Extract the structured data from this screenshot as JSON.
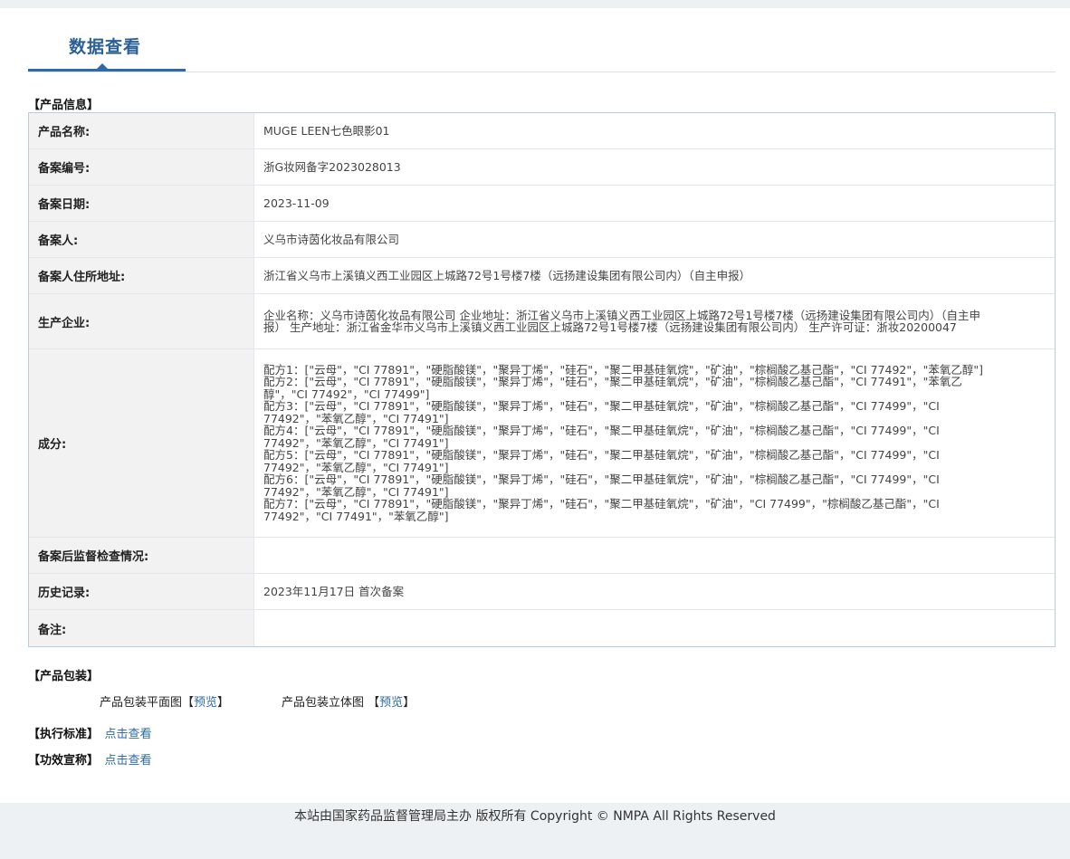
{
  "tab": {
    "title": "数据查看"
  },
  "sections": {
    "product_info": "【产品信息】",
    "packaging": "【产品包装】",
    "standard": "【执行标准】",
    "efficacy": "【功效宣称】"
  },
  "rows": {
    "name": {
      "label": "产品名称:",
      "value": "MUGE LEEN七色眼影01"
    },
    "record_no": {
      "label": "备案编号:",
      "value": "浙G妆网备字2023028013"
    },
    "record_date": {
      "label": "备案日期:",
      "value": "2023-11-09"
    },
    "registrant": {
      "label": "备案人:",
      "value": "义乌市诗茵化妆品有限公司"
    },
    "registrant_addr": {
      "label": "备案人住所地址:",
      "value": "浙江省义乌市上溪镇义西工业园区上城路72号1号楼7楼（远扬建设集团有限公司内）（自主申报）"
    },
    "manufacturer": {
      "label": "生产企业:",
      "value": "企业名称：义乌市诗茵化妆品有限公司 企业地址：浙江省义乌市上溪镇义西工业园区上城路72号1号楼7楼（远扬建设集团有限公司内）（自主申报） 生产地址：浙江省金华市义乌市上溪镇义西工业园区上城路72号1号楼7楼（远扬建设集团有限公司内） 生产许可证：浙妆20200047"
    },
    "ingredients": {
      "label": "成分:",
      "formulas": [
        "配方1：[\"云母\"，\"CI 77891\"，\"硬脂酸镁\"，\"聚异丁烯\"，\"硅石\"，\"聚二甲基硅氧烷\"，\"矿油\"，\"棕榈酸乙基己酯\"，\"CI 77492\"，\"苯氧乙醇\"]",
        "配方2：[\"云母\"，\"CI 77891\"，\"硬脂酸镁\"，\"聚异丁烯\"，\"硅石\"，\"聚二甲基硅氧烷\"，\"矿油\"，\"棕榈酸乙基己酯\"，\"CI 77491\"，\"苯氧乙醇\"，\"CI 77492\"，\"CI 77499\"]",
        "配方3：[\"云母\"，\"CI 77891\"，\"硬脂酸镁\"，\"聚异丁烯\"，\"硅石\"，\"聚二甲基硅氧烷\"，\"矿油\"，\"棕榈酸乙基己酯\"，\"CI 77499\"，\"CI 77492\"，\"苯氧乙醇\"，\"CI 77491\"]",
        "配方4：[\"云母\"，\"CI 77891\"，\"硬脂酸镁\"，\"聚异丁烯\"，\"硅石\"，\"聚二甲基硅氧烷\"，\"矿油\"，\"棕榈酸乙基己酯\"，\"CI 77499\"，\"CI 77492\"，\"苯氧乙醇\"，\"CI 77491\"]",
        "配方5：[\"云母\"，\"CI 77891\"，\"硬脂酸镁\"，\"聚异丁烯\"，\"硅石\"，\"聚二甲基硅氧烷\"，\"矿油\"，\"棕榈酸乙基己酯\"，\"CI 77499\"，\"CI 77492\"，\"苯氧乙醇\"，\"CI 77491\"]",
        "配方6：[\"云母\"，\"CI 77891\"，\"硬脂酸镁\"，\"聚异丁烯\"，\"硅石\"，\"聚二甲基硅氧烷\"，\"矿油\"，\"棕榈酸乙基己酯\"，\"CI 77499\"，\"CI 77492\"，\"苯氧乙醇\"，\"CI 77491\"]",
        "配方7：[\"云母\"，\"CI 77891\"，\"硬脂酸镁\"，\"聚异丁烯\"，\"硅石\"，\"聚二甲基硅氧烷\"，\"矿油\"，\"CI 77499\"，\"棕榈酸乙基己酯\"，\"CI 77492\"，\"CI 77491\"，\"苯氧乙醇\"]"
      ]
    },
    "inspection": {
      "label": "备案后监督检查情况:",
      "value": ""
    },
    "history": {
      "label": "历史记录:",
      "value": "2023年11月17日 首次备案"
    },
    "remark": {
      "label": "备注:",
      "value": ""
    }
  },
  "packaging": {
    "flat_label": "产品包装平面图",
    "flat_link": "预览",
    "solid_label": "产品包装立体图",
    "solid_link": "预览",
    "open_bracket": "【",
    "close_bracket": "】"
  },
  "links": {
    "standard": "点击查看",
    "efficacy": "点击查看"
  },
  "footer": {
    "text": "本站由国家药品监督管理局主办 版权所有 Copyright © NMPA All Rights Reserved"
  },
  "colors": {
    "accent": "#2c6ba8",
    "title": "#2c5f93",
    "label_bg": "#f2f2f2",
    "page_bg": "#eef1f4"
  }
}
